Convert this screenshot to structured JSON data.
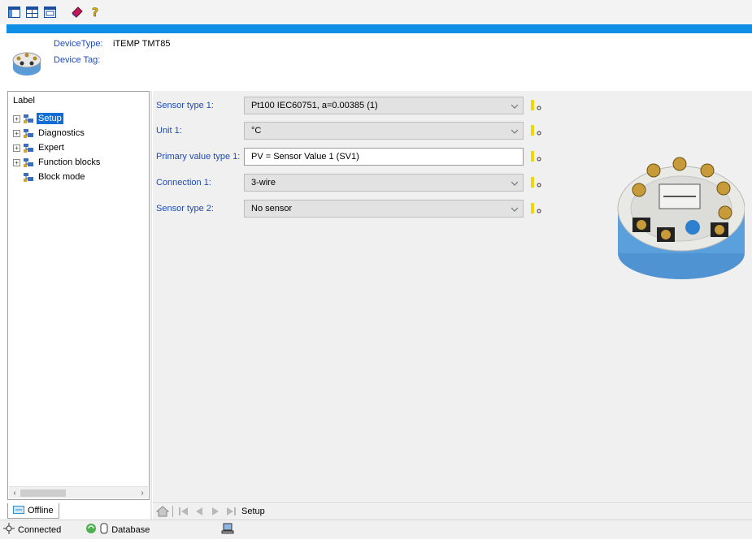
{
  "toolbar": {
    "icons": [
      "view-layout-1-icon",
      "view-layout-2-icon",
      "view-layout-3-icon",
      "book-icon",
      "help-icon"
    ]
  },
  "header": {
    "device_type_label": "DeviceType:",
    "device_type_value": "iTEMP TMT85",
    "device_tag_label": "Device Tag:"
  },
  "tree": {
    "title": "Label",
    "items": [
      {
        "label": "Setup",
        "expandable": true,
        "selected": true
      },
      {
        "label": "Diagnostics",
        "expandable": true,
        "selected": false
      },
      {
        "label": "Expert",
        "expandable": true,
        "selected": false
      },
      {
        "label": "Function blocks",
        "expandable": true,
        "selected": false
      },
      {
        "label": "Block mode",
        "expandable": false,
        "selected": false
      }
    ]
  },
  "params": [
    {
      "label": "Sensor type 1:",
      "value": "Pt100 IEC60751, a=0.00385 (1)",
      "kind": "dropdown"
    },
    {
      "label": "Unit 1:",
      "value": "°C",
      "kind": "dropdown"
    },
    {
      "label": "Primary value type 1:",
      "value": "PV = Sensor Value 1 (SV1)",
      "kind": "text"
    },
    {
      "label": "Connection 1:",
      "value": "3-wire",
      "kind": "dropdown"
    },
    {
      "label": "Sensor type 2:",
      "value": "No sensor",
      "kind": "dropdown"
    }
  ],
  "left_tab": {
    "label": "Offline"
  },
  "bottom_nav": {
    "current": "Setup"
  },
  "status": {
    "connection": "Connected",
    "database": "Database"
  },
  "colors": {
    "accent": "#0f8ee6",
    "label_blue": "#1f4bb4",
    "selection": "#0f6dd6"
  }
}
